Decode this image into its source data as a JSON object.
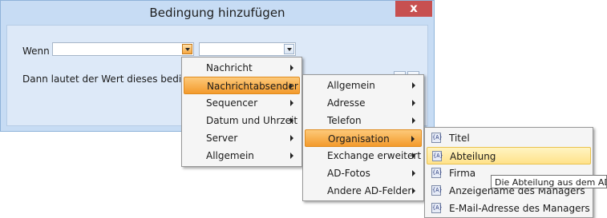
{
  "dialog": {
    "title": "Bedingung hinzufügen",
    "close_glyph": "x",
    "label_if": "Wenn",
    "label_then": "Dann lautet der Wert dieses bedingten Fe"
  },
  "menu_main": [
    {
      "label": "Nachricht",
      "submenu": true
    },
    {
      "label": "Nachrichtabsender",
      "submenu": true
    },
    {
      "label": "Sequencer",
      "submenu": true
    },
    {
      "label": "Datum und Uhrzeit",
      "submenu": true
    },
    {
      "label": "Server",
      "submenu": true
    },
    {
      "label": "Allgemein",
      "submenu": true
    }
  ],
  "menu_sender": [
    {
      "label": "Allgemein",
      "submenu": true
    },
    {
      "label": "Adresse",
      "submenu": true
    },
    {
      "label": "Telefon",
      "submenu": true
    },
    {
      "label": "Organisation",
      "submenu": true
    },
    {
      "label": "Exchange erweitert",
      "submenu": true
    },
    {
      "label": "AD-Fotos",
      "submenu": true
    },
    {
      "label": "Andere AD-Felder",
      "submenu": true
    }
  ],
  "menu_org": [
    {
      "label": "Titel",
      "icon": "field-icon",
      "icon_text": "{A}"
    },
    {
      "label": "Abteilung",
      "icon": "field-icon",
      "icon_text": "{A}"
    },
    {
      "label": "Firma",
      "icon": "field-icon",
      "icon_text": "{A}"
    },
    {
      "label": "Anzeigename des Managers",
      "icon": "field-icon",
      "icon_text": "{A}"
    },
    {
      "label": "E-Mail-Adresse des Managers",
      "icon": "field-icon",
      "icon_text": "{A}"
    }
  ],
  "tooltip": "Die Abteilung aus dem AD",
  "colors": {
    "highlight": "#f39a2c",
    "hover": "#ffe28a",
    "window": "#c7dcf4"
  }
}
